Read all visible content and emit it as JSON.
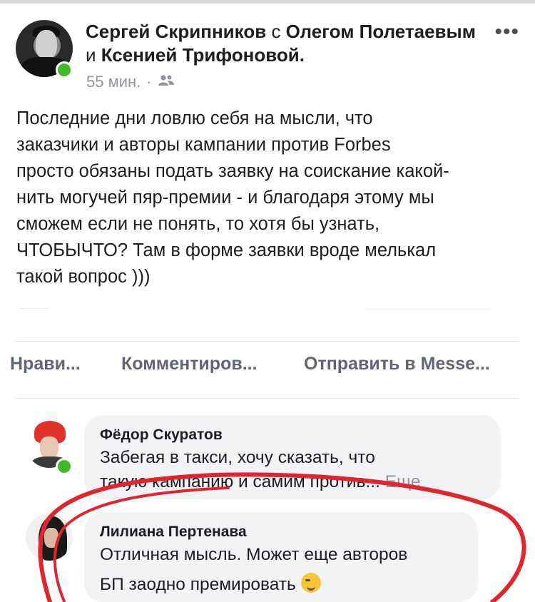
{
  "post": {
    "author": "Сергей Скрипников",
    "with_word": "с",
    "tagged_1": "Олегом Полетаевым",
    "and_word": "и",
    "tagged_2": "Ксенией Трифоновой",
    "time": "55 мин.",
    "separator": "·",
    "audience_icon": "friends-icon",
    "more_icon": "more-dots-icon",
    "more_glyph": "•••",
    "text": "Последние дни ловлю себя на мысли, что\nзаказчики и авторы кампании против Forbes\nпросто обязаны подать заявку на соискание какой-\nнить могучей пяр-премии - и благодаря этому мы\nсможем если не понять, то хотя бы узнать,\nЧТОБЫЧТО? Там в форме заявки вроде мелькал\nтакой вопрос )))"
  },
  "actions": {
    "like": "Нрави...",
    "comment": "Комментиров...",
    "send": "Отправить в Messe..."
  },
  "comments": [
    {
      "author": "Фёдор Скуратов",
      "line1": "Забегая в такси, хочу сказать, что",
      "line2": "такую кампанию и самим против...",
      "see_more": "Еще"
    },
    {
      "author": "Лилиана Пертенава",
      "line1": "Отличная мысль. Может еще авторов",
      "line2": "БП заодно премировать",
      "emoji": "wink-emoji"
    }
  ],
  "colors": {
    "online": "#42b72a",
    "annotation": "#e0262d"
  }
}
